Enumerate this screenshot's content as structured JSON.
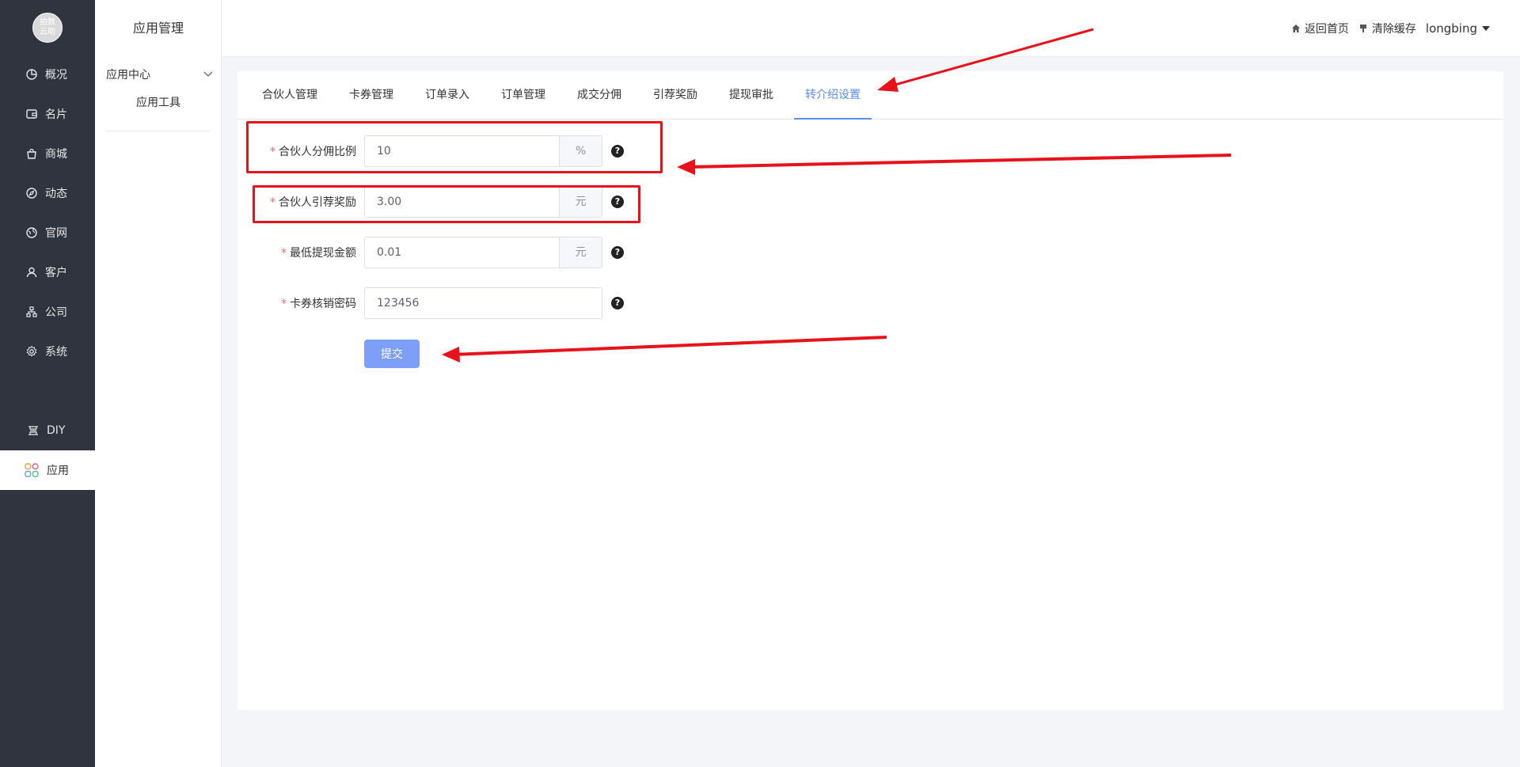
{
  "brand": {
    "logo_text": "拍数\n云助"
  },
  "sidebar": {
    "items": [
      {
        "label": "概况",
        "icon": "pie-chart-icon"
      },
      {
        "label": "名片",
        "icon": "wallet-icon"
      },
      {
        "label": "商城",
        "icon": "shopping-bag-icon"
      },
      {
        "label": "动态",
        "icon": "compass-icon"
      },
      {
        "label": "官网",
        "icon": "globe-icon"
      },
      {
        "label": "客户",
        "icon": "user-icon"
      },
      {
        "label": "公司",
        "icon": "org-chart-icon"
      },
      {
        "label": "系统",
        "icon": "gear-icon"
      },
      {
        "label": "DIY",
        "icon": "diy-icon"
      },
      {
        "label": "应用",
        "icon": "apps-grid-icon",
        "active": true
      }
    ]
  },
  "submenu": {
    "title": "应用管理",
    "group": "应用中心",
    "sub_item": "应用工具"
  },
  "header": {
    "home": "返回首页",
    "clear_cache": "清除缓存",
    "user": "longbing"
  },
  "tabs": [
    {
      "label": "合伙人管理"
    },
    {
      "label": "卡券管理"
    },
    {
      "label": "订单录入"
    },
    {
      "label": "订单管理"
    },
    {
      "label": "成交分佣"
    },
    {
      "label": "引荐奖励"
    },
    {
      "label": "提现审批"
    },
    {
      "label": "转介绍设置",
      "active": true
    }
  ],
  "form": {
    "fields": [
      {
        "label": "合伙人分佣比例",
        "value": "10",
        "suffix": "%"
      },
      {
        "label": "合伙人引荐奖励",
        "value": "3.00",
        "suffix": "元"
      },
      {
        "label": "最低提现金额",
        "value": "0.01",
        "suffix": "元"
      },
      {
        "label": "卡券核销密码",
        "value": "123456"
      }
    ],
    "submit": "提交"
  },
  "colors": {
    "accent": "#5a8dee",
    "sidebar_bg": "#30343f",
    "annotation": "#e8131a"
  }
}
